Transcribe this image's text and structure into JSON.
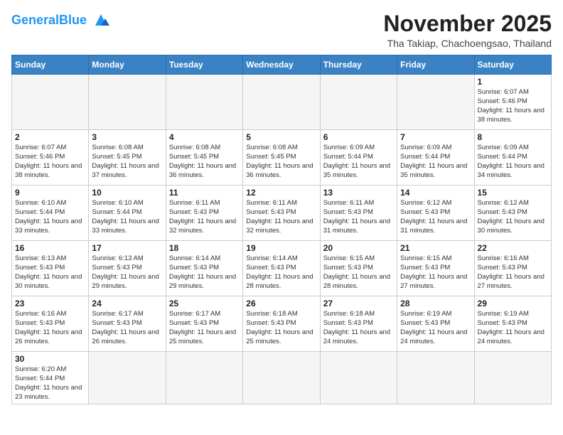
{
  "header": {
    "logo_general": "General",
    "logo_blue": "Blue",
    "month_title": "November 2025",
    "location": "Tha Takiap, Chachoengsao, Thailand"
  },
  "days_of_week": [
    "Sunday",
    "Monday",
    "Tuesday",
    "Wednesday",
    "Thursday",
    "Friday",
    "Saturday"
  ],
  "weeks": [
    [
      {
        "day": "",
        "info": ""
      },
      {
        "day": "",
        "info": ""
      },
      {
        "day": "",
        "info": ""
      },
      {
        "day": "",
        "info": ""
      },
      {
        "day": "",
        "info": ""
      },
      {
        "day": "",
        "info": ""
      },
      {
        "day": "1",
        "info": "Sunrise: 6:07 AM\nSunset: 5:46 PM\nDaylight: 11 hours\nand 38 minutes."
      }
    ],
    [
      {
        "day": "2",
        "info": "Sunrise: 6:07 AM\nSunset: 5:46 PM\nDaylight: 11 hours\nand 38 minutes."
      },
      {
        "day": "3",
        "info": "Sunrise: 6:08 AM\nSunset: 5:45 PM\nDaylight: 11 hours\nand 37 minutes."
      },
      {
        "day": "4",
        "info": "Sunrise: 6:08 AM\nSunset: 5:45 PM\nDaylight: 11 hours\nand 36 minutes."
      },
      {
        "day": "5",
        "info": "Sunrise: 6:08 AM\nSunset: 5:45 PM\nDaylight: 11 hours\nand 36 minutes."
      },
      {
        "day": "6",
        "info": "Sunrise: 6:09 AM\nSunset: 5:44 PM\nDaylight: 11 hours\nand 35 minutes."
      },
      {
        "day": "7",
        "info": "Sunrise: 6:09 AM\nSunset: 5:44 PM\nDaylight: 11 hours\nand 35 minutes."
      },
      {
        "day": "8",
        "info": "Sunrise: 6:09 AM\nSunset: 5:44 PM\nDaylight: 11 hours\nand 34 minutes."
      }
    ],
    [
      {
        "day": "9",
        "info": "Sunrise: 6:10 AM\nSunset: 5:44 PM\nDaylight: 11 hours\nand 33 minutes."
      },
      {
        "day": "10",
        "info": "Sunrise: 6:10 AM\nSunset: 5:44 PM\nDaylight: 11 hours\nand 33 minutes."
      },
      {
        "day": "11",
        "info": "Sunrise: 6:11 AM\nSunset: 5:43 PM\nDaylight: 11 hours\nand 32 minutes."
      },
      {
        "day": "12",
        "info": "Sunrise: 6:11 AM\nSunset: 5:43 PM\nDaylight: 11 hours\nand 32 minutes."
      },
      {
        "day": "13",
        "info": "Sunrise: 6:11 AM\nSunset: 5:43 PM\nDaylight: 11 hours\nand 31 minutes."
      },
      {
        "day": "14",
        "info": "Sunrise: 6:12 AM\nSunset: 5:43 PM\nDaylight: 11 hours\nand 31 minutes."
      },
      {
        "day": "15",
        "info": "Sunrise: 6:12 AM\nSunset: 5:43 PM\nDaylight: 11 hours\nand 30 minutes."
      }
    ],
    [
      {
        "day": "16",
        "info": "Sunrise: 6:13 AM\nSunset: 5:43 PM\nDaylight: 11 hours\nand 30 minutes."
      },
      {
        "day": "17",
        "info": "Sunrise: 6:13 AM\nSunset: 5:43 PM\nDaylight: 11 hours\nand 29 minutes."
      },
      {
        "day": "18",
        "info": "Sunrise: 6:14 AM\nSunset: 5:43 PM\nDaylight: 11 hours\nand 29 minutes."
      },
      {
        "day": "19",
        "info": "Sunrise: 6:14 AM\nSunset: 5:43 PM\nDaylight: 11 hours\nand 28 minutes."
      },
      {
        "day": "20",
        "info": "Sunrise: 6:15 AM\nSunset: 5:43 PM\nDaylight: 11 hours\nand 28 minutes."
      },
      {
        "day": "21",
        "info": "Sunrise: 6:15 AM\nSunset: 5:43 PM\nDaylight: 11 hours\nand 27 minutes."
      },
      {
        "day": "22",
        "info": "Sunrise: 6:16 AM\nSunset: 5:43 PM\nDaylight: 11 hours\nand 27 minutes."
      }
    ],
    [
      {
        "day": "23",
        "info": "Sunrise: 6:16 AM\nSunset: 5:43 PM\nDaylight: 11 hours\nand 26 minutes."
      },
      {
        "day": "24",
        "info": "Sunrise: 6:17 AM\nSunset: 5:43 PM\nDaylight: 11 hours\nand 26 minutes."
      },
      {
        "day": "25",
        "info": "Sunrise: 6:17 AM\nSunset: 5:43 PM\nDaylight: 11 hours\nand 25 minutes."
      },
      {
        "day": "26",
        "info": "Sunrise: 6:18 AM\nSunset: 5:43 PM\nDaylight: 11 hours\nand 25 minutes."
      },
      {
        "day": "27",
        "info": "Sunrise: 6:18 AM\nSunset: 5:43 PM\nDaylight: 11 hours\nand 24 minutes."
      },
      {
        "day": "28",
        "info": "Sunrise: 6:19 AM\nSunset: 5:43 PM\nDaylight: 11 hours\nand 24 minutes."
      },
      {
        "day": "29",
        "info": "Sunrise: 6:19 AM\nSunset: 5:43 PM\nDaylight: 11 hours\nand 24 minutes."
      }
    ],
    [
      {
        "day": "30",
        "info": "Sunrise: 6:20 AM\nSunset: 5:44 PM\nDaylight: 11 hours\nand 23 minutes."
      },
      {
        "day": "",
        "info": ""
      },
      {
        "day": "",
        "info": ""
      },
      {
        "day": "",
        "info": ""
      },
      {
        "day": "",
        "info": ""
      },
      {
        "day": "",
        "info": ""
      },
      {
        "day": "",
        "info": ""
      }
    ]
  ]
}
